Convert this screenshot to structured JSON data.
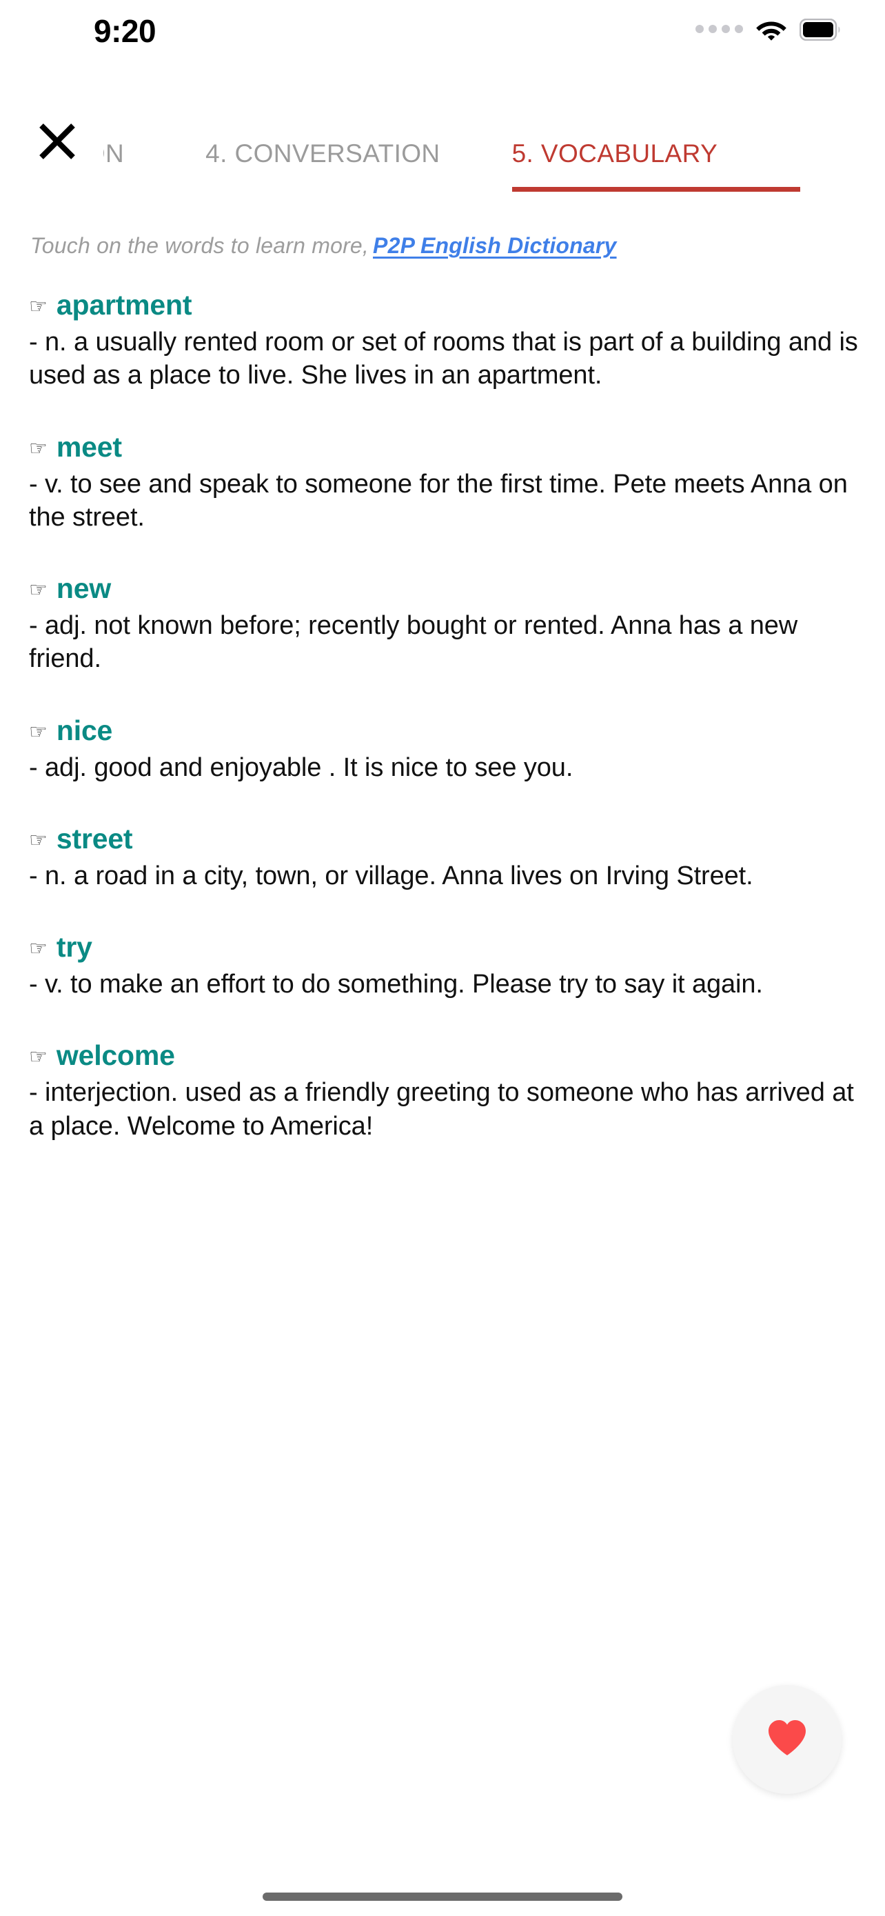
{
  "status_bar": {
    "time": "9:20",
    "signal_icon": "signal-dots-icon",
    "wifi_icon": "wifi-icon",
    "battery_icon": "battery-full-icon"
  },
  "header": {
    "close_icon": "close-icon",
    "tabs": [
      {
        "label": "CIATION",
        "active": false,
        "partial": true
      },
      {
        "label": "4. CONVERSATION",
        "active": false,
        "partial": false
      },
      {
        "label": "5. VOCABULARY",
        "active": true,
        "partial": false
      }
    ],
    "active_tab_color": "#bf3a31",
    "inactive_tab_color": "#9b9b9b"
  },
  "content": {
    "hint_text": "Touch on the words to learn more,",
    "dictionary_link": "P2P English Dictionary",
    "link_color": "#3f7fe8",
    "word_color": "#0a8a84",
    "pointer_icon": "pointing-hand-icon",
    "entries": [
      {
        "word": "apartment",
        "definition": "- n. a usually rented room or set of rooms that is part of a building and is used as a place to live. She lives in an apartment."
      },
      {
        "word": "meet",
        "definition": "- v. to see and speak to someone for the first time. Pete meets Anna on the street."
      },
      {
        "word": "new",
        "definition": "- adj. not known before; recently bought or rented. Anna has a new friend."
      },
      {
        "word": "nice",
        "definition": "- adj. good and enjoyable . It is nice to see you."
      },
      {
        "word": "street",
        "definition": "- n. a road in a city, town, or village. Anna lives on Irving Street."
      },
      {
        "word": "try",
        "definition": "- v. to make an effort to do something. Please try to say it again."
      },
      {
        "word": "welcome",
        "definition": "- interjection. used as a friendly greeting to someone who has arrived at a place. Welcome to America!"
      }
    ]
  },
  "favorite_button": {
    "icon": "heart-icon",
    "color": "#fb4a4a"
  },
  "home_indicator": {
    "icon": "home-indicator"
  }
}
